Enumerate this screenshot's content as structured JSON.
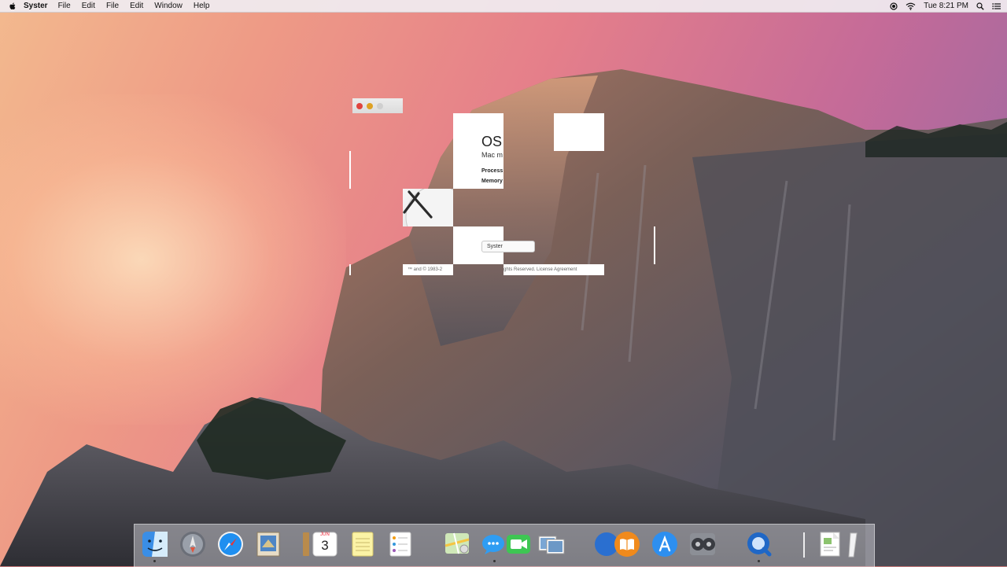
{
  "menubar": {
    "apple_icon": "apple-icon",
    "app_name": "Syster",
    "items": [
      "File",
      "Edit",
      "File",
      "Edit",
      "Window",
      "Help"
    ],
    "clock": "Tue 8:21 PM",
    "status_icons": [
      "record-icon",
      "wifi-icon",
      "spotlight-icon",
      "notification-center-icon"
    ]
  },
  "about_window": {
    "title_fragment": "OS",
    "model_fragment": "Mac m",
    "processor_label_fragment": "Process",
    "memory_label_fragment": "Memory",
    "button_fragment": "Syster",
    "footer_left": "™ and © 1983-2",
    "footer_right": "ghts Reserved. License Agreement"
  },
  "dock": {
    "calendar": {
      "month": "JUN",
      "day": "3"
    },
    "apps": [
      "finder-icon",
      "launchpad-icon",
      "safari-icon",
      "mail-icon",
      "contacts-icon",
      "calendar-icon",
      "notes-icon",
      "reminders-icon",
      "maps-icon",
      "messages-icon",
      "facetime-icon",
      "photos-icon",
      "itunes-icon",
      "ibooks-icon",
      "app-store-icon",
      "system-preferences-icon",
      "quicktime-icon",
      "preview-icon",
      "trash-icon"
    ]
  },
  "colors": {
    "menubar_bg": "#f0ecf0",
    "close_button": "#e0443e",
    "minimize_button": "#dea123",
    "sky_top": "#ee9a86",
    "sky_right": "#8b67a6"
  }
}
